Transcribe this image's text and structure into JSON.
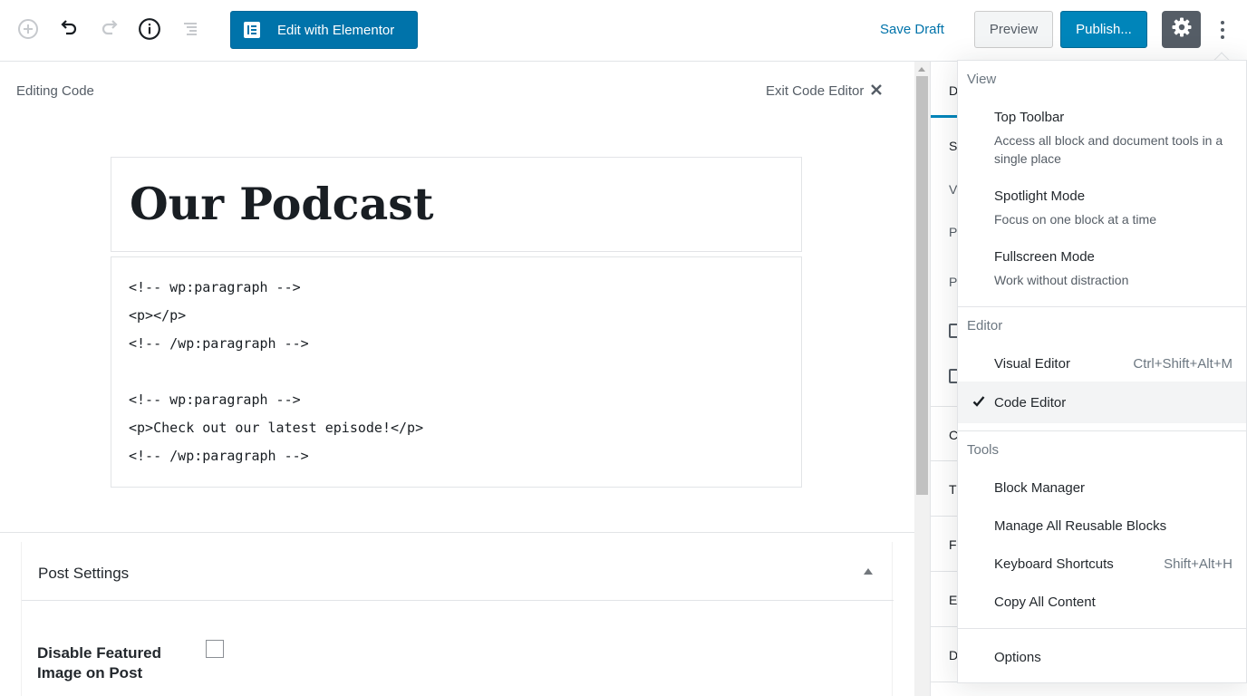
{
  "toolbar": {
    "elementor_label": "Edit with Elementor",
    "save_draft_label": "Save Draft",
    "preview_label": "Preview",
    "publish_label": "Publish...",
    "icons": [
      "add-block-icon",
      "undo-icon",
      "redo-icon",
      "info-icon",
      "block-navigation-icon",
      "gear-icon",
      "more-menu-icon"
    ]
  },
  "editor": {
    "editing_label": "Editing Code",
    "exit_label": "Exit Code Editor",
    "post_title": "Our Podcast",
    "code_lines": [
      "<!-- wp:paragraph -->",
      "<p></p>",
      "<!-- /wp:paragraph -->",
      "",
      "<!-- wp:paragraph -->",
      "<p>Check out our latest episode!</p>",
      "<!-- /wp:paragraph -->"
    ]
  },
  "post_settings": {
    "title": "Post Settings",
    "disable_featured_label": "Disable Featured Image on Post",
    "disable_featured_checked": false
  },
  "sidebar": {
    "fragments": [
      "D",
      "S",
      "V",
      "P",
      "P",
      "C",
      "T",
      "F",
      "E",
      "D"
    ]
  },
  "menu": {
    "view_label": "View",
    "top_toolbar": "Top Toolbar",
    "top_toolbar_desc": "Access all block and document tools in a single place",
    "spotlight": "Spotlight Mode",
    "spotlight_desc": "Focus on one block at a time",
    "fullscreen": "Fullscreen Mode",
    "fullscreen_desc": "Work without distraction",
    "editor_label": "Editor",
    "visual_editor": "Visual Editor",
    "visual_shortcut": "Ctrl+Shift+Alt+M",
    "code_editor": "Code Editor",
    "code_editor_active": true,
    "tools_label": "Tools",
    "block_manager": "Block Manager",
    "reusable_blocks": "Manage All Reusable Blocks",
    "keyboard_shortcuts": "Keyboard Shortcuts",
    "keyboard_shortcut_keys": "Shift+Alt+H",
    "copy_content": "Copy All Content",
    "options": "Options"
  },
  "colors": {
    "primary": "#0085ba",
    "elementor": "#0073aa",
    "active_bg": "#f3f4f5"
  }
}
